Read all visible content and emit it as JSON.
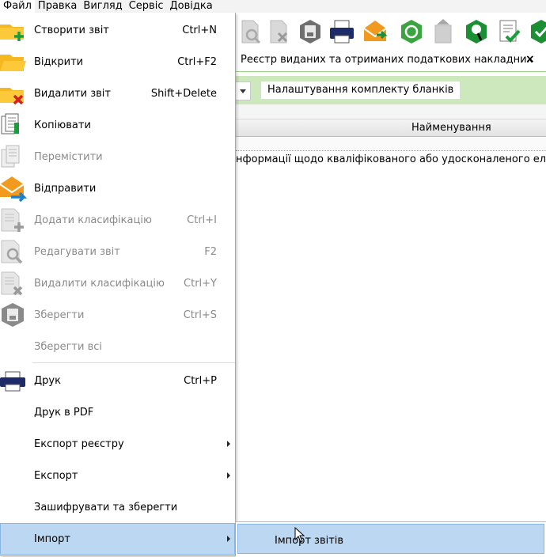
{
  "menubar": {
    "items": [
      {
        "label": "Файл"
      },
      {
        "label": "Правка"
      },
      {
        "label": "Вигляд"
      },
      {
        "label": "Сервіс"
      },
      {
        "label": "Довідка"
      }
    ]
  },
  "tab": {
    "title": "Реєстр виданих та отриманих податкових накладних",
    "close": "×"
  },
  "filterbar": {
    "blanks_button": "Налаштування комплекту бланків"
  },
  "grid": {
    "column_header": "Найменування",
    "rows": [
      {
        "name": "нформації щодо кваліфікованого або удосконаленого елект"
      }
    ]
  },
  "file_menu": {
    "items": [
      {
        "label": "Створити звіт",
        "shortcut": "Ctrl+N",
        "icon": "folder-new-icon"
      },
      {
        "label": "Відкрити",
        "shortcut": "Ctrl+F2",
        "icon": "folder-open-icon"
      },
      {
        "label": "Видалити звіт",
        "shortcut": "Shift+Delete",
        "icon": "folder-delete-icon"
      },
      {
        "label": "Копіювати",
        "shortcut": "",
        "icon": "copy-icon"
      },
      {
        "label": "Перемістити",
        "shortcut": "",
        "icon": "move-icon"
      },
      {
        "label": "Відправити",
        "shortcut": "",
        "icon": "send-envelope-icon"
      },
      {
        "label": "Додати класифікацію",
        "shortcut": "Ctrl+I",
        "icon": "add-classification-icon"
      },
      {
        "label": "Редагувати звіт",
        "shortcut": "F2",
        "icon": "edit-report-icon"
      },
      {
        "label": "Видалити класифікацію",
        "shortcut": "Ctrl+Y",
        "icon": "delete-classification-icon"
      },
      {
        "label": "Зберегти",
        "shortcut": "Ctrl+S",
        "icon": "save-icon"
      },
      {
        "label": "Зберегти всі",
        "shortcut": "",
        "icon": ""
      },
      {
        "label": "Друк",
        "shortcut": "Ctrl+P",
        "icon": "printer-icon"
      },
      {
        "label": "Друк в PDF",
        "shortcut": "",
        "icon": ""
      },
      {
        "label": "Експорт реєстру",
        "shortcut": "",
        "icon": ""
      },
      {
        "label": "Експорт",
        "shortcut": "",
        "icon": ""
      },
      {
        "label": "Зашифрувати та зберегти",
        "shortcut": "",
        "icon": ""
      },
      {
        "label": "Імпорт",
        "shortcut": "",
        "icon": ""
      }
    ]
  },
  "import_submenu": {
    "items": [
      {
        "label": "Імпорт звітів"
      }
    ]
  },
  "colors": {
    "highlight": "#bcd7f2",
    "highlight_border": "#86b5e6",
    "green_bar": "#cde8bd",
    "folder": "#f5b820",
    "disabled_text": "#8a8a8a"
  }
}
